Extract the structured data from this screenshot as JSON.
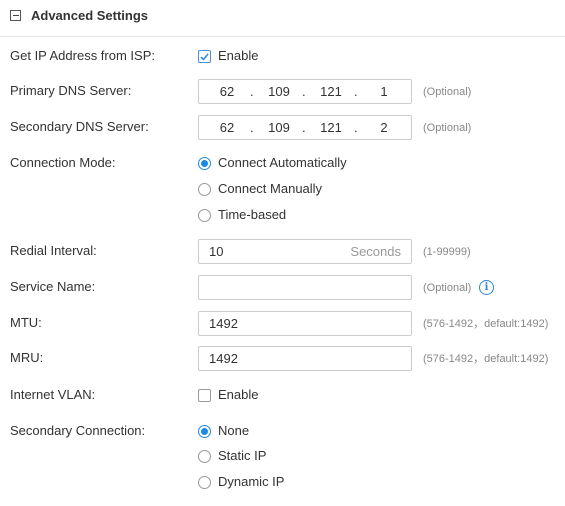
{
  "section": {
    "title": "Advanced Settings"
  },
  "get_ip": {
    "label": "Get IP Address from ISP:",
    "option": "Enable",
    "checked": true
  },
  "primary_dns": {
    "label": "Primary DNS Server:",
    "octets": [
      "62",
      "109",
      "121",
      "1"
    ],
    "hint": "(Optional)"
  },
  "secondary_dns": {
    "label": "Secondary DNS Server:",
    "octets": [
      "62",
      "109",
      "121",
      "2"
    ],
    "hint": "(Optional)"
  },
  "connection_mode": {
    "label": "Connection Mode:",
    "options": [
      "Connect Automatically",
      "Connect Manually",
      "Time-based"
    ],
    "selected": "Connect Automatically"
  },
  "redial": {
    "label": "Redial Interval:",
    "value": "10",
    "unit": "Seconds",
    "hint": "(1-99999)"
  },
  "service_name": {
    "label": "Service Name:",
    "value": "",
    "hint": "(Optional)"
  },
  "mtu": {
    "label": "MTU:",
    "value": "1492",
    "hint": "(576-1492，default:1492)"
  },
  "mru": {
    "label": "MRU:",
    "value": "1492",
    "hint": "(576-1492，default:1492)"
  },
  "internet_vlan": {
    "label": "Internet VLAN:",
    "option": "Enable",
    "checked": false
  },
  "secondary_connection": {
    "label": "Secondary Connection:",
    "options": [
      "None",
      "Static IP",
      "Dynamic IP"
    ],
    "selected": "None"
  },
  "colors": {
    "accent": "#1e88e5",
    "border": "#cccccc",
    "hint": "#888888"
  }
}
